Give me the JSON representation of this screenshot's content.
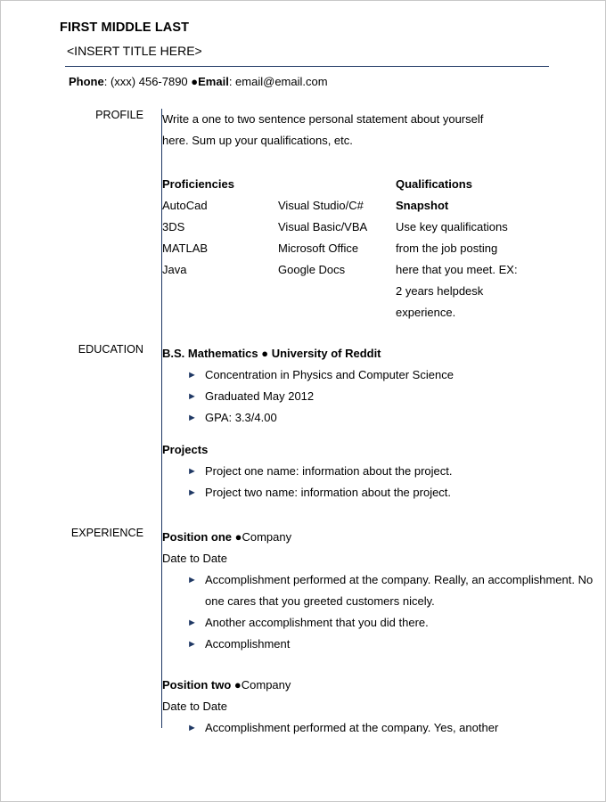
{
  "header": {
    "name": "FIRST MIDDLE LAST",
    "title": "<INSERT TITLE HERE>",
    "phone_label": "Phone",
    "phone_value": ": (xxx) 456-7890 ",
    "separator": "●",
    "email_label": "Email",
    "email_value": ": email@email.com"
  },
  "colors": {
    "rule": "#1f3864",
    "bullet": "#1f3864",
    "page_border": "#c8c8c8",
    "text": "#000000"
  },
  "icons": {
    "bullet_triangle": "►",
    "bullet_dot": "●"
  },
  "sections": {
    "profile": {
      "label": "PROFILE",
      "statement_line1": "Write a one to two sentence personal statement  about yourself",
      "statement_line2": "here. Sum up your qualifications, etc.",
      "skills": {
        "proficiencies_heading": "Proficiencies",
        "qualifications_heading_line1": "Qualifications",
        "qualifications_heading_line2": "Snapshot",
        "column_one": [
          "AutoCad",
          "3DS",
          "MATLAB",
          "Java"
        ],
        "column_two": [
          "Visual Studio/C#",
          "Visual Basic/VBA",
          "Microsoft Office",
          "Google Docs"
        ],
        "qualifications_text": [
          "Use key qualifications",
          "from the job posting",
          "here that you meet. EX:",
          "2 years helpdesk",
          "experience."
        ]
      }
    },
    "education": {
      "label": "EDUCATION",
      "degree_line": "B.S. Mathematics ● University of Reddit",
      "bullets": [
        "Concentration in Physics and Computer Science",
        "Graduated May 2012",
        "GPA: 3.3/4.00"
      ],
      "projects_heading": "Projects",
      "project_bullets": [
        "Project one name:  information about the project.",
        "Project two name:  information about the project."
      ]
    },
    "experience": {
      "label": "EXPERIENCE",
      "positions": [
        {
          "title": "Position one ",
          "company": "●Company",
          "dates": "Date to Date",
          "bullets": [
            "Accomplishment performed at the company.  Really,  an accomplishment. No one cares that you greeted customers nicely.",
            "Another accomplishment that you did there.",
            "Accomplishment"
          ]
        },
        {
          "title": "Position two ",
          "company": "●Company",
          "dates": "Date to Date",
          "bullets": [
            "Accomplishment performed at the company.  Yes, another"
          ]
        }
      ]
    }
  }
}
